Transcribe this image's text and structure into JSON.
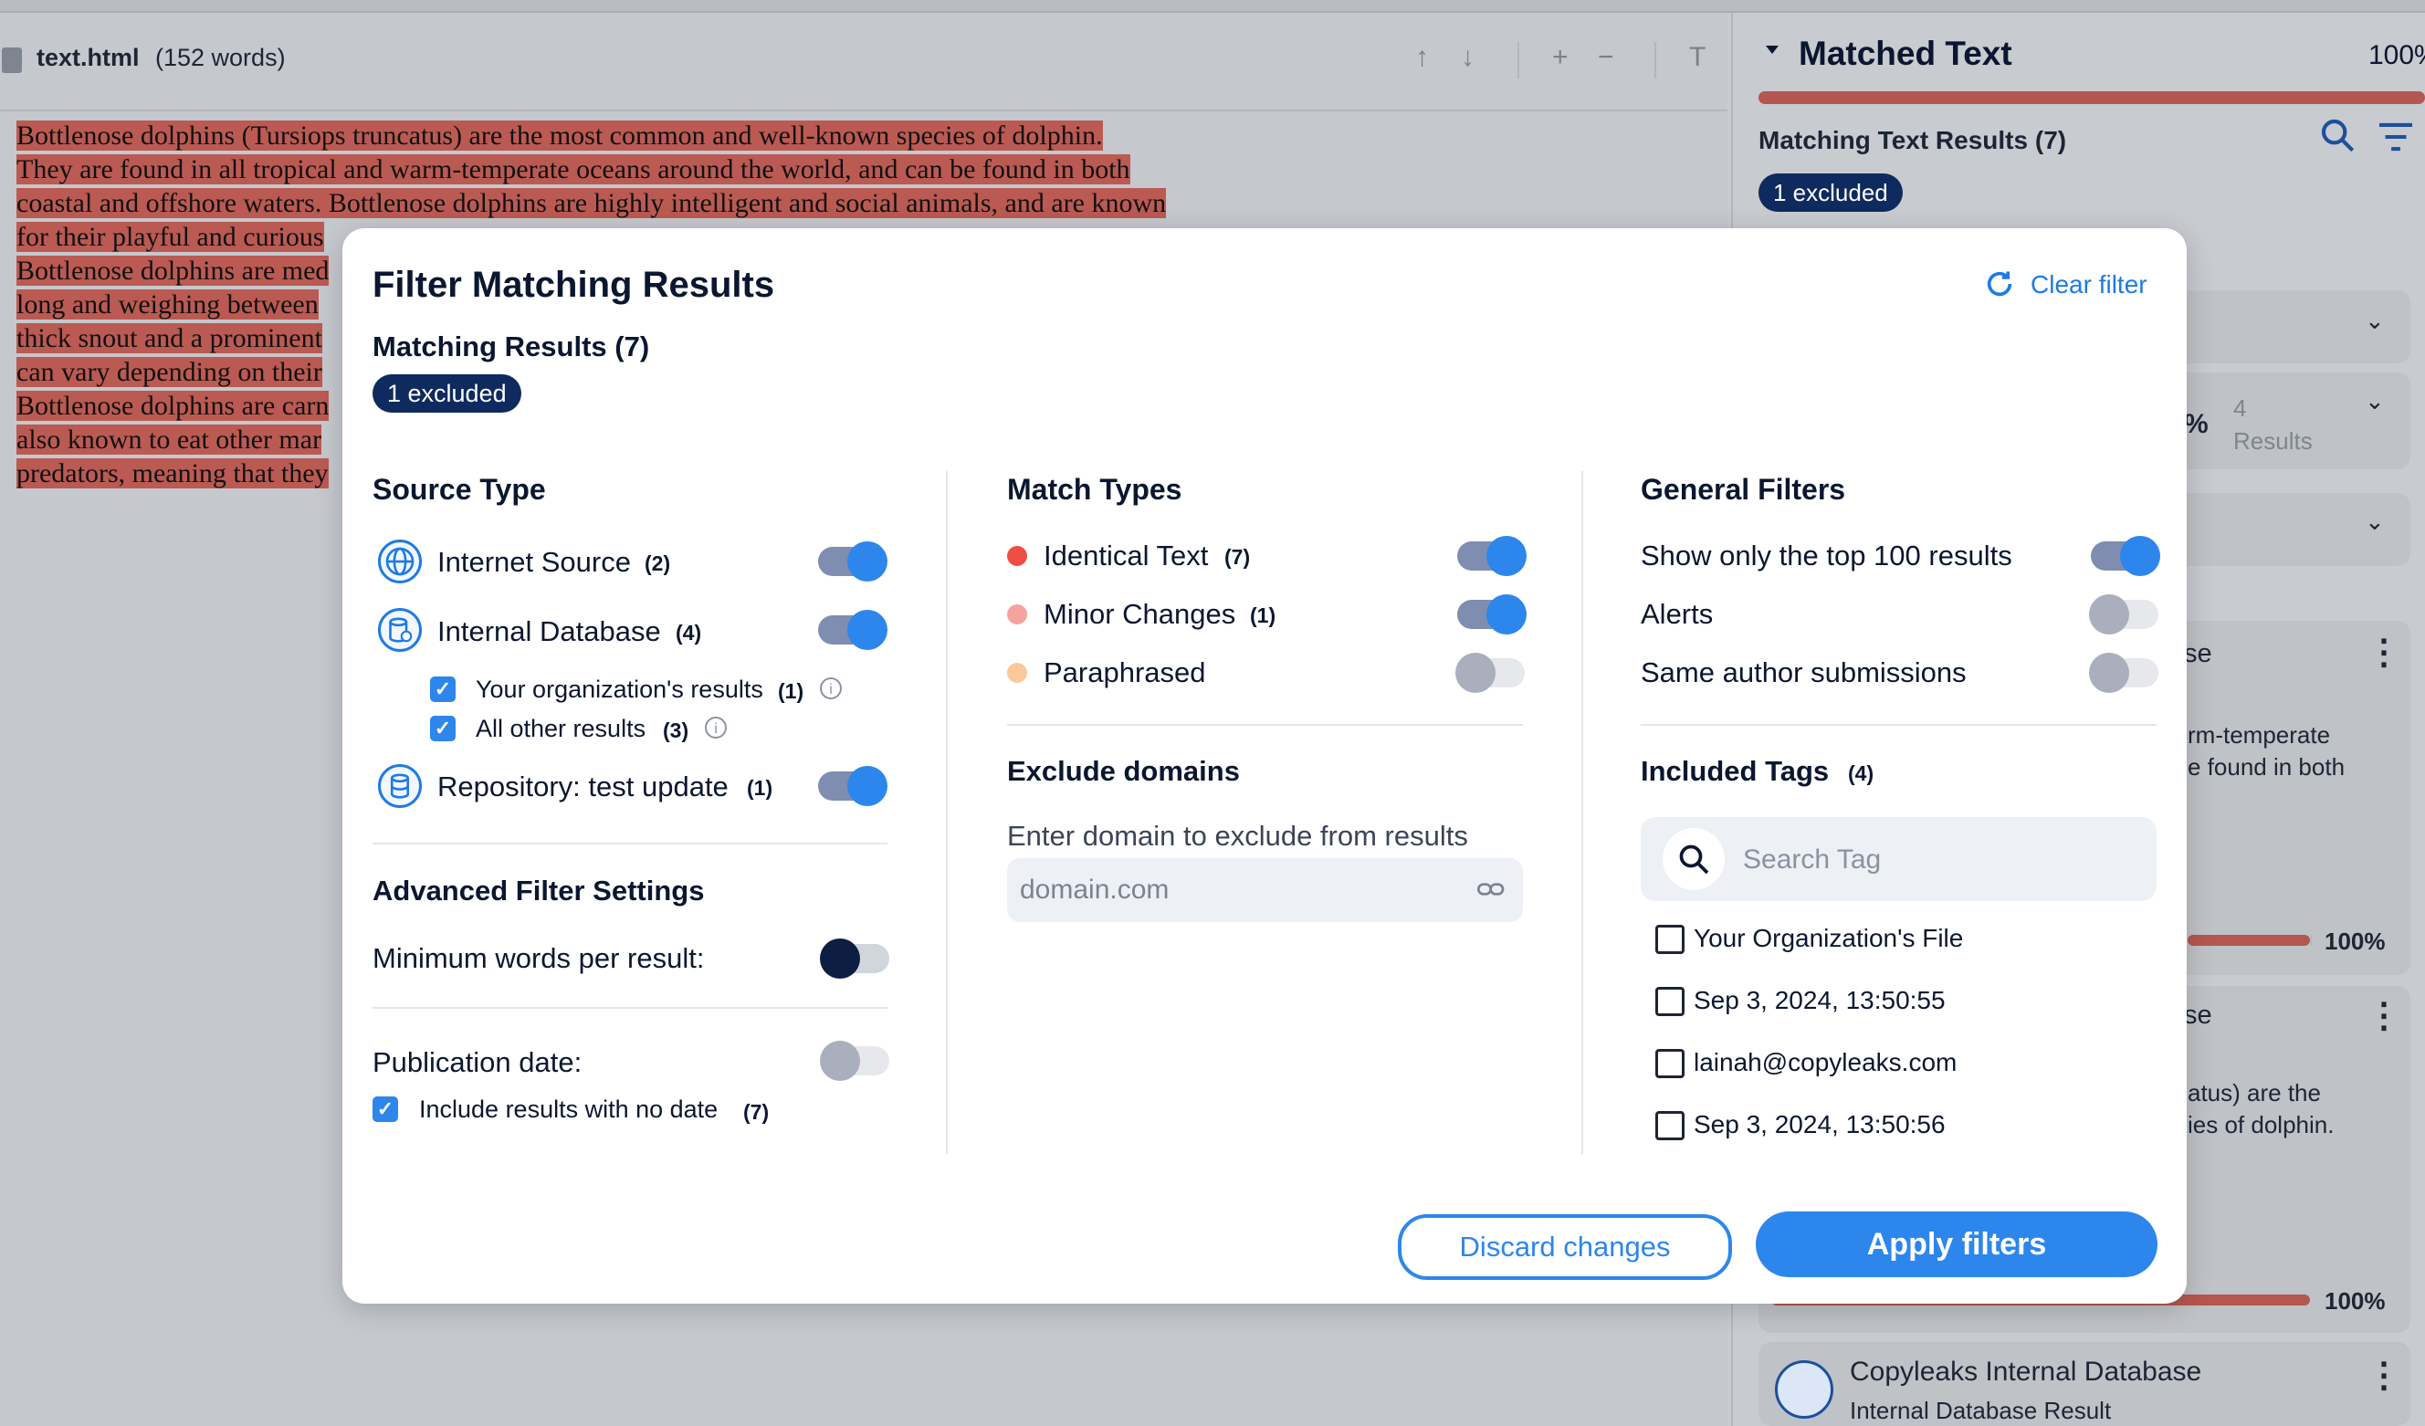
{
  "doc": {
    "filename": "text.html",
    "word_count": "(152 words)",
    "toolbar": [
      "↑",
      "↓",
      "+",
      "−",
      "T"
    ],
    "lines": [
      {
        "text": "Bottlenose dolphins (Tursiops truncatus) are the most common and well-known species of dolphin.",
        "hl": true
      },
      {
        "text": "They are found in all tropical and warm-temperate oceans around the world, and can be found in both",
        "hl": true
      },
      {
        "text": "coastal and offshore waters. Bottlenose dolphins are highly intelligent and social animals, and are known",
        "hl": true
      },
      {
        "text": "for their playful and curious",
        "hl": true
      },
      {
        "text": "Bottlenose dolphins are med",
        "hl": true
      },
      {
        "text": "long and weighing between",
        "hl": true
      },
      {
        "text": "thick snout and a prominent",
        "hl": true
      },
      {
        "text": "can vary depending on their",
        "hl": true
      },
      {
        "text": "Bottlenose dolphins are carn",
        "hl": true
      },
      {
        "text": "also known to eat other mar",
        "hl": true
      },
      {
        "text": "predators, meaning that they",
        "hl": true
      }
    ]
  },
  "right": {
    "title": "Matched Text",
    "percent": "100%",
    "results_label": "Matching Text Results",
    "results_count": "(7)",
    "excluded_badge": "1 excluded",
    "partial_pct": "%",
    "results_num": "4",
    "results_word": "Results",
    "card1_title_frag": "se",
    "card1_text": [
      "rm-temperate",
      "e found in both"
    ],
    "card1_pct": "100%",
    "card2_title_frag": "se",
    "card2_text": [
      "atus) are the",
      "ies of dolphin."
    ],
    "card2_pct": "100%",
    "db_card_title": "Copyleaks Internal Database",
    "db_card_sub": "Internal Database Result"
  },
  "modal": {
    "title": "Filter Matching Results",
    "clear_filter": "Clear filter",
    "subtitle": "Matching Results (7)",
    "excluded_badge": "1 excluded",
    "source_type": {
      "heading": "Source Type",
      "internet": {
        "label": "Internet Source",
        "count": "(2)",
        "on": true
      },
      "internal": {
        "label": "Internal Database",
        "count": "(4)",
        "on": true
      },
      "org": {
        "label": "Your organization's results",
        "count": "(1)",
        "checked": true
      },
      "others": {
        "label": "All other results",
        "count": "(3)",
        "checked": true
      },
      "repo": {
        "label": "Repository: test update",
        "count": "(1)",
        "on": true
      }
    },
    "advanced": {
      "heading": "Advanced Filter Settings",
      "min_words": "Minimum words per result:",
      "pub_date": "Publication date:",
      "no_date": "Include results with no date",
      "no_date_count": "(7)"
    },
    "match_types": {
      "heading": "Match Types",
      "identical": {
        "label": "Identical Text",
        "count": "(7)",
        "color": "#ee4e44",
        "on": true
      },
      "minor": {
        "label": "Minor Changes",
        "count": "(1)",
        "color": "#f6a3a0",
        "on": true
      },
      "para": {
        "label": "Paraphrased",
        "color": "#fbc999",
        "on": false
      }
    },
    "exclude": {
      "heading": "Exclude domains",
      "label": "Enter domain to exclude from results",
      "placeholder": "domain.com"
    },
    "general": {
      "heading": "General Filters",
      "top100": "Show only the top 100 results",
      "alerts": "Alerts",
      "same_author": "Same author submissions"
    },
    "tags": {
      "heading": "Included Tags",
      "count": "(4)",
      "search_placeholder": "Search Tag",
      "items": [
        "Your Organization's File",
        "Sep 3, 2024, 13:50:55",
        "lainah@copyleaks.com",
        "Sep 3, 2024, 13:50:56"
      ]
    },
    "discard": "Discard changes",
    "apply": "Apply filters"
  }
}
